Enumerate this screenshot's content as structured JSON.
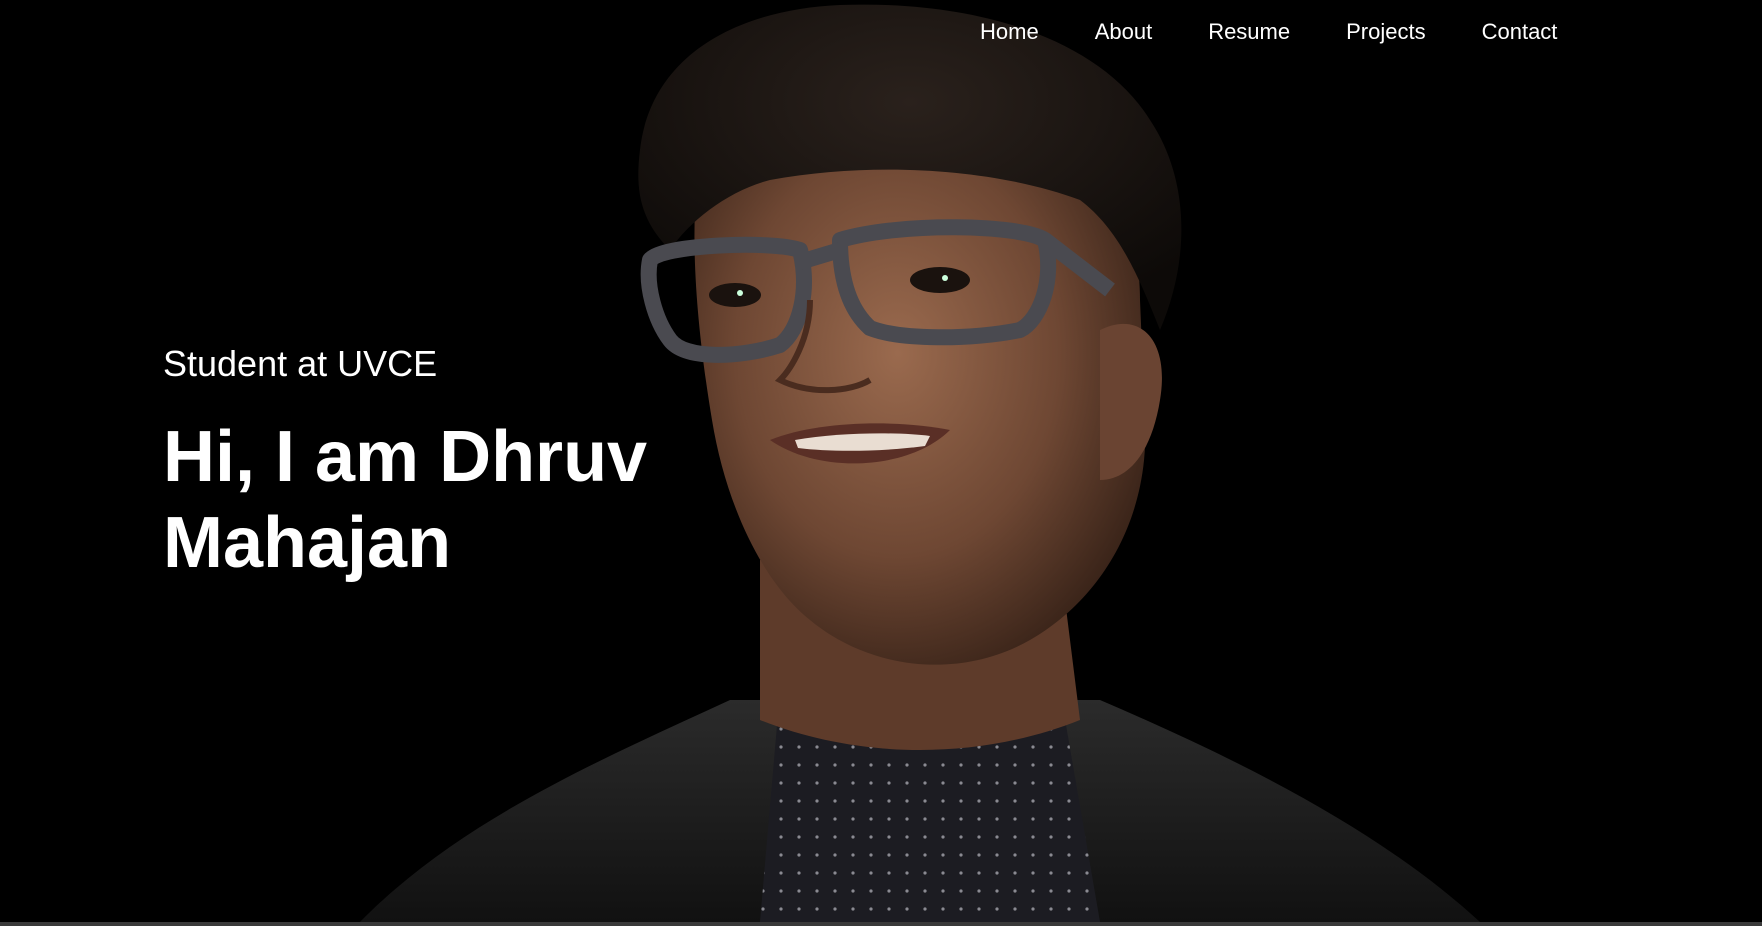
{
  "nav": {
    "items": [
      {
        "label": "Home"
      },
      {
        "label": "About"
      },
      {
        "label": "Resume"
      },
      {
        "label": "Projects"
      },
      {
        "label": "Contact"
      }
    ]
  },
  "hero": {
    "subtitle": "Student at UVCE",
    "headline": "Hi, I am Dhruv Mahajan"
  },
  "colors": {
    "background": "#000000",
    "text": "#ffffff"
  },
  "images": {
    "portrait": "portrait-photo"
  }
}
